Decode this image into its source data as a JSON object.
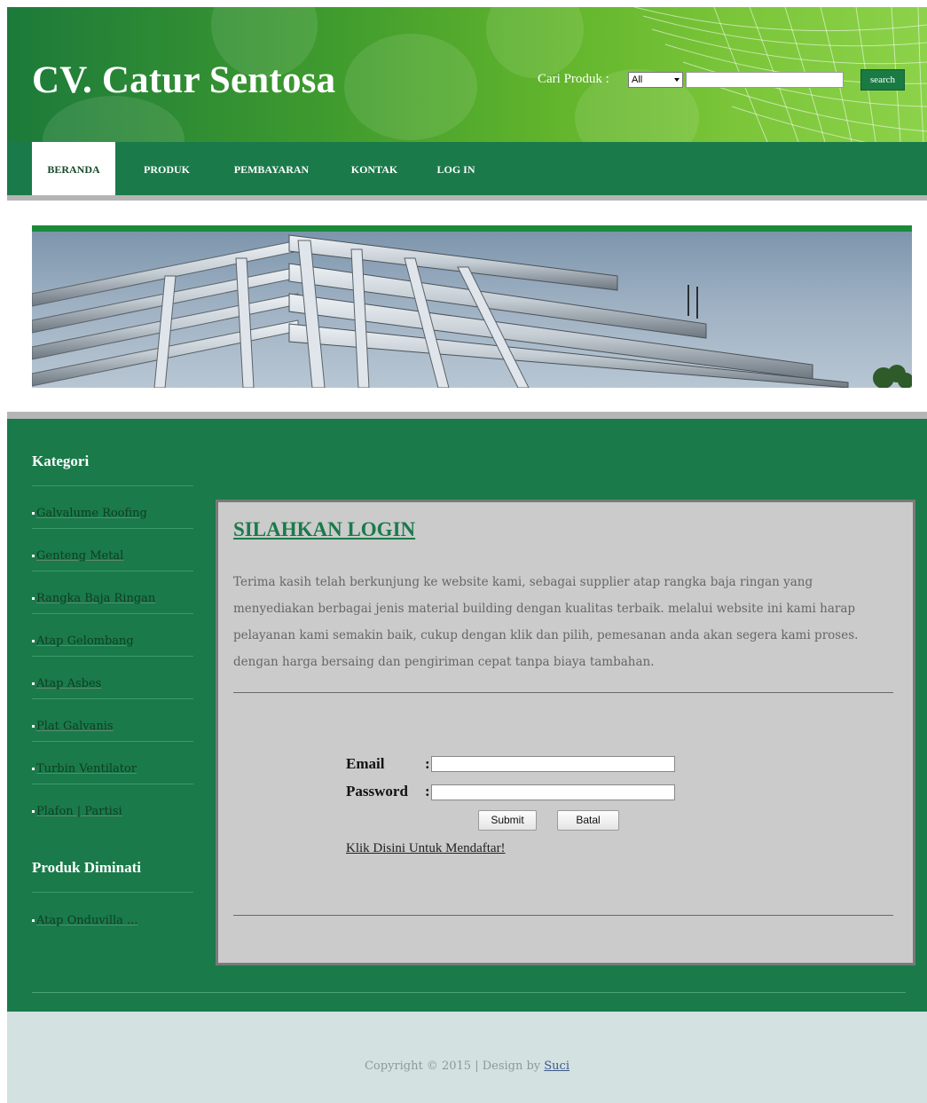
{
  "header": {
    "site_title": "CV. Catur Sentosa",
    "search_label": "Cari Produk :",
    "search_select_value": "All",
    "search_button": "search"
  },
  "nav": {
    "items": [
      {
        "label": "BERANDA",
        "active": true
      },
      {
        "label": "PRODUK"
      },
      {
        "label": "PEMBAYARAN"
      },
      {
        "label": "KONTAK"
      },
      {
        "label": "LOG IN"
      }
    ]
  },
  "sidebar": {
    "categories_heading": "Kategori",
    "categories": [
      "Galvalume Roofing",
      "Genteng Metal",
      "Rangka Baja Ringan",
      "Atap Gelombang",
      "Atap Asbes",
      "Plat Galvanis",
      "Turbin Ventilator",
      "Plafon | Partisi"
    ],
    "popular_heading": "Produk Diminati",
    "popular": [
      "Atap Onduvilla ..."
    ]
  },
  "content": {
    "title": "SILAHKAN LOGIN",
    "paragraph": "Terima kasih telah berkunjung ke website kami, sebagai supplier atap rangka baja ringan yang menyediakan berbagai jenis material building dengan kualitas terbaik. melalui website ini kami harap pelayanan kami semakin baik, cukup dengan klik dan pilih, pemesanan anda akan segera kami proses. dengan harga bersaing dan pengiriman cepat tanpa biaya tambahan.",
    "email_label": "Email",
    "email_colon": ":",
    "password_label": "Password",
    "password_colon": ":",
    "submit_button": "Submit",
    "cancel_button": "Batal",
    "register_link": "Klik Disini Untuk Mendaftar!"
  },
  "footer": {
    "copyright_text": "Copyright © 2015 | Design by ",
    "designer": "Suci"
  },
  "colors": {
    "primary_green": "#1a7a4a",
    "header_light_green": "#7cc63a",
    "content_gray": "#cbcbcb",
    "footer_bg": "#d3e1e1"
  }
}
